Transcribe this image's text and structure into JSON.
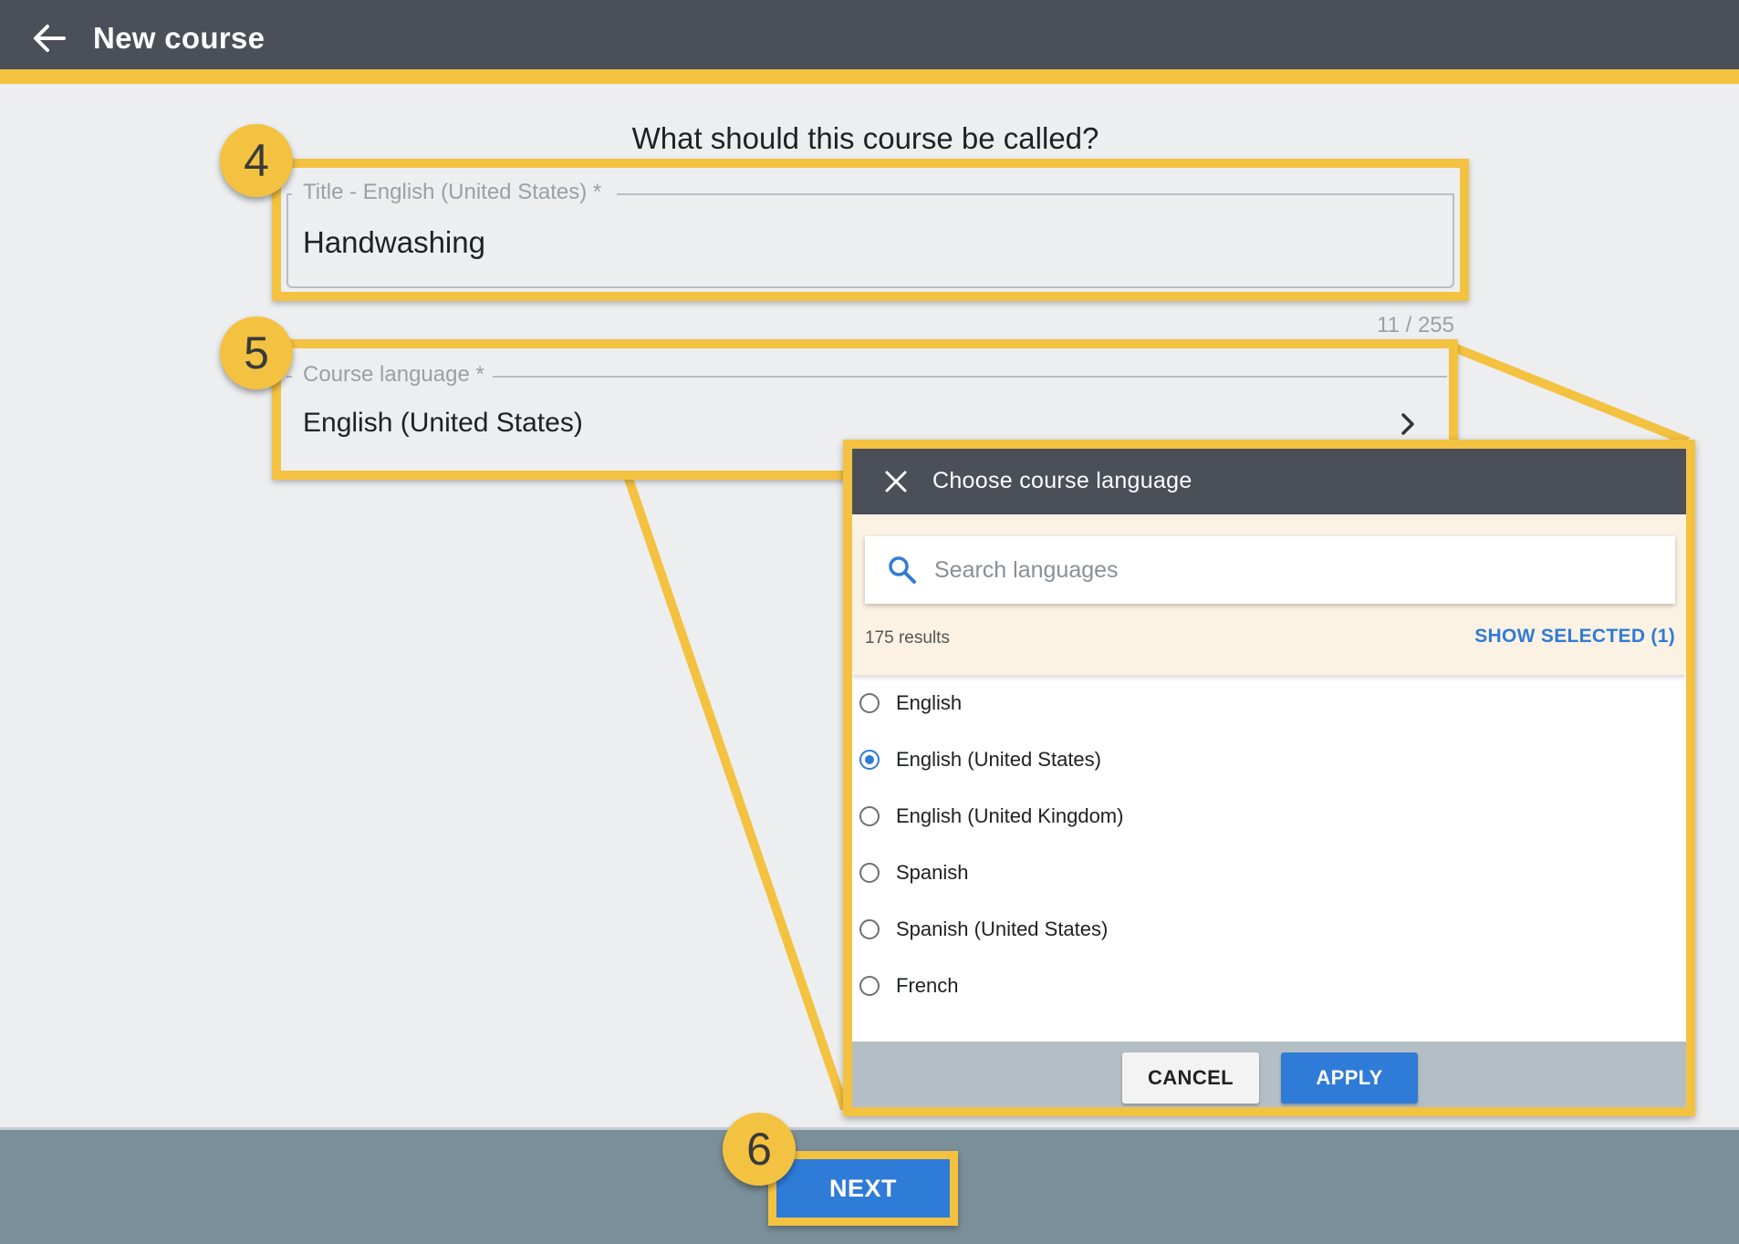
{
  "header": {
    "back_icon": "arrow-left-icon",
    "title": "New course"
  },
  "form": {
    "question": "What should this course be called?",
    "title_field": {
      "label": "Title - English (United States) *",
      "value": "Handwashing",
      "counter": "11 / 255"
    },
    "language_field": {
      "label": "Course language *",
      "value": "English (United States)",
      "chevron_icon": "chevron-right-icon"
    }
  },
  "callouts": {
    "step_4": "4",
    "step_5": "5",
    "step_6": "6",
    "color": "#f4c241"
  },
  "dialog": {
    "title": "Choose course language",
    "close_icon": "close-icon",
    "search": {
      "icon": "search-icon",
      "placeholder": "Search languages",
      "value": ""
    },
    "results_count": "175 results",
    "show_selected": "SHOW SELECTED (1)",
    "languages": [
      {
        "label": "English",
        "selected": false
      },
      {
        "label": "English (United States)",
        "selected": true
      },
      {
        "label": "English (United Kingdom)",
        "selected": false
      },
      {
        "label": "Spanish",
        "selected": false
      },
      {
        "label": "Spanish (United States)",
        "selected": false
      },
      {
        "label": "French",
        "selected": false
      }
    ],
    "cancel_label": "CANCEL",
    "apply_label": "APPLY"
  },
  "footer": {
    "next_label": "NEXT"
  },
  "colors": {
    "header_bg": "#4a4f58",
    "accent_yellow": "#f4c241",
    "primary_blue": "#2f7bd8",
    "footer_bg": "#7a8f99"
  }
}
